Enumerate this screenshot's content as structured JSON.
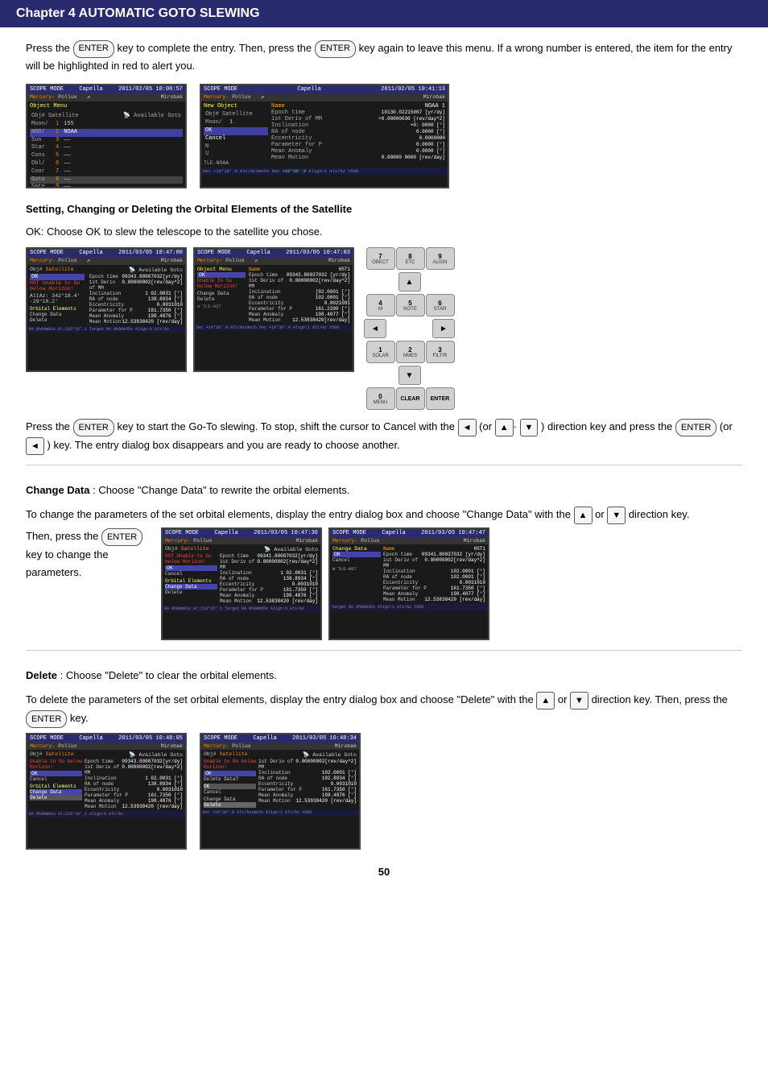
{
  "chapter": {
    "title": "Chapter 4  AUTOMATIC GOTO SLEWING"
  },
  "intro": {
    "text": "Press the",
    "key_enter": "ENTER",
    "text2": "key to complete the entry.  Then, press the",
    "text3": "key again to leave this menu.  If a wrong number is entered, the item for the entry will be highlighted in red to alert you."
  },
  "section1": {
    "heading": "Setting, Changing or Deleting the Orbital Elements of the Satellite",
    "ok_text": "OK: Choose OK to slew the telescope to the satellite you chose.",
    "goto_text": "Press the",
    "key_enter": "ENTER",
    "goto_text2": "key to start the Go-To slewing.  To stop, shift the cursor to Cancel with the",
    "goto_text3": "(or",
    "key_arrow_up": "▲",
    "key_arrow_down": "▼",
    "goto_text4": ") direction key and press the",
    "goto_text5": "(or",
    "key_back": "◄",
    "goto_text6": ") key.  The entry dialog box disappears and you are ready to choose another."
  },
  "change_data": {
    "heading": "Change Data",
    "text": ": Choose \"Change Data\" to rewrite the orbital elements.",
    "para": "To change the parameters of the set orbital elements, display the entry dialog box and choose \"Change Data\" with the",
    "key_up": "▲",
    "or_text": "or",
    "key_down": "▼",
    "direction": "direction key.",
    "then_text": "Then, press the",
    "key_enter": "ENTER",
    "key_label": "key to change the",
    "params": "parameters."
  },
  "delete": {
    "heading": "Delete",
    "text": ": Choose \"Delete\" to clear the orbital elements.",
    "para": "To delete the parameters of the set orbital elements, display the entry dialog box and choose \"Delete\" with the",
    "key_up": "▲",
    "or_text": "or",
    "key_down": "▼",
    "direction": "direction key.  Then,",
    "press": "press the",
    "key_enter": "ENTER",
    "key_label": "key."
  },
  "page_number": "50",
  "keypad": {
    "buttons": [
      {
        "label": "7",
        "sub": "OBECT"
      },
      {
        "label": "8",
        "sub": "ETC"
      },
      {
        "label": "9",
        "sub": "ALIGN"
      },
      {
        "label": "4",
        "sub": "M"
      },
      {
        "label": "5",
        "sub": "NOTE"
      },
      {
        "label": "6",
        "sub": "STAR"
      },
      {
        "label": "1",
        "sub": "SOLAR"
      },
      {
        "label": "2",
        "sub": "NMES"
      },
      {
        "label": "3",
        "sub": "FILT/R"
      },
      {
        "label": "0",
        "sub": "MENU"
      },
      {
        "label": "CLEAR",
        "sub": ""
      },
      {
        "label": "ENTER",
        "sub": ""
      }
    ],
    "up": "▲",
    "down": "▼",
    "left": "◄",
    "right": "►"
  }
}
